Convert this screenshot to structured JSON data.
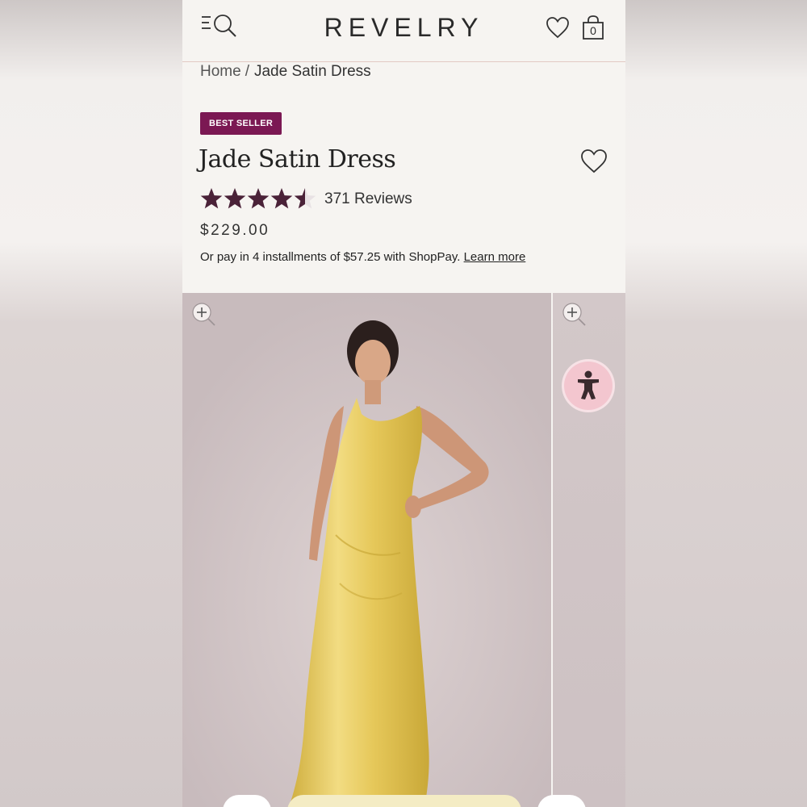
{
  "header": {
    "logo": "REVELRY",
    "bag_count": "0",
    "icons": {
      "menu": "menu-search-icon",
      "wishlist": "heart-icon",
      "bag": "shopping-bag-icon"
    }
  },
  "breadcrumb": {
    "home": "Home",
    "separator": "/",
    "current": "Jade Satin Dress"
  },
  "product": {
    "badge": "BEST SELLER",
    "title": "Jade Satin Dress",
    "rating": 4.5,
    "rating_max": 5,
    "reviews_label": "371 Reviews",
    "price": "$229.00",
    "installments_text": "Or pay in 4 installments of $57.25 with ShopPay.",
    "installments_link": "Learn more"
  },
  "colors": {
    "badge_bg": "#7b1853",
    "star_fill": "#4a2238",
    "dress": "#e6c85a",
    "accessibility_bg": "#f3c6cf"
  },
  "gallery": {
    "zoom_icon": "zoom-plus-icon",
    "accessibility_icon": "accessibility-person-icon"
  }
}
